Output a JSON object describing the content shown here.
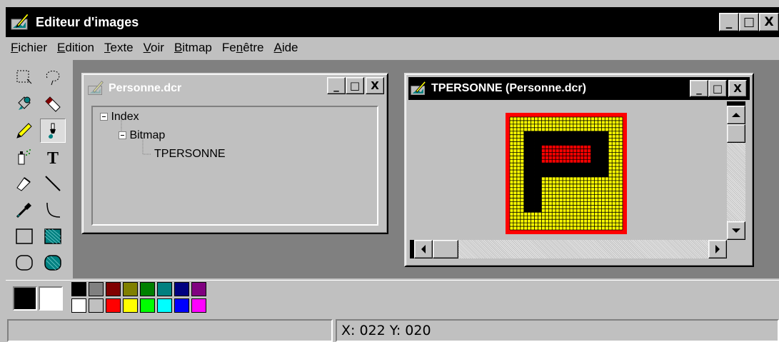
{
  "app": {
    "title": "Editeur d'images",
    "controls": {
      "minimize": "_",
      "maximize": "□",
      "close": "X"
    }
  },
  "menu": [
    {
      "label": "Fichier",
      "accel": "F"
    },
    {
      "label": "Edition",
      "accel": "E"
    },
    {
      "label": "Texte",
      "accel": "T"
    },
    {
      "label": "Voir",
      "accel": "V"
    },
    {
      "label": "Bitmap",
      "accel": "B"
    },
    {
      "label": "Fenêtre",
      "accel": "n"
    },
    {
      "label": "Aide",
      "accel": "A"
    }
  ],
  "tools": [
    "rect-select-icon",
    "lasso-select-icon",
    "fill-bucket-icon",
    "eraser-icon",
    "pencil-icon",
    "brush-icon",
    "airbrush-icon",
    "text-icon",
    "pen-icon",
    "line-icon",
    "eyedropper-icon",
    "curve-icon",
    "rectangle-icon",
    "filled-rectangle-icon",
    "rounded-rect-icon",
    "filled-rounded-rect-icon"
  ],
  "active_tool": "brush-icon",
  "tool_glyphs": {
    "text": "T"
  },
  "doc_window": {
    "title": "Personne.dcr",
    "tree": [
      {
        "label": "Index",
        "level": 0,
        "expanded": true
      },
      {
        "label": "Bitmap",
        "level": 1,
        "expanded": true
      },
      {
        "label": "TPERSONNE",
        "level": 2,
        "expanded": false
      }
    ]
  },
  "bitmap_window": {
    "title": "TPERSONNE (Personne.dcr)",
    "bitmap_cells": {
      "cols": 32,
      "rows": 32
    },
    "colors": {
      "border": "#ff0000",
      "background": "#ffff00",
      "stroke": "#000000",
      "fill": "#ff0000",
      "grid": "#000000"
    }
  },
  "colors": {
    "foreground": "#000000",
    "background": "#ffffff",
    "palette_top": [
      "#000000",
      "#808080",
      "#800000",
      "#808000",
      "#008000",
      "#008080",
      "#000080",
      "#800080"
    ],
    "palette_bottom": [
      "#ffffff",
      "#c0c0c0",
      "#ff0000",
      "#ffff00",
      "#00ff00",
      "#00ffff",
      "#0000ff",
      "#ff00ff"
    ]
  },
  "status": {
    "message": "",
    "coords": "X: 022  Y: 020"
  }
}
